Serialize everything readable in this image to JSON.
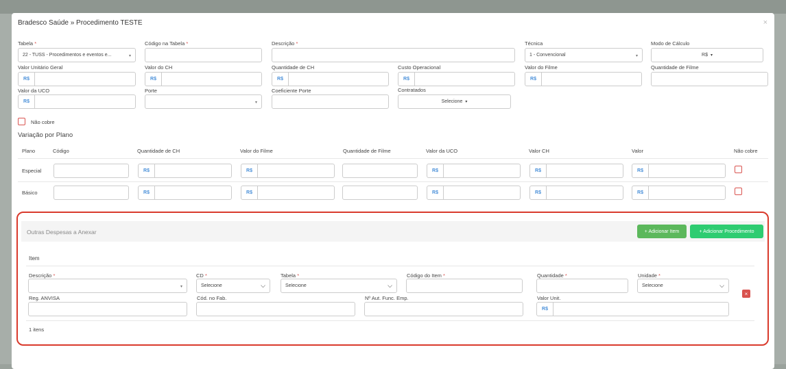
{
  "modal": {
    "title": "Bradesco Saúde » Procedimento TESTE",
    "close": "×"
  },
  "form": {
    "required_mark": "*",
    "tabela": {
      "label": "Tabela",
      "value": "22 - TUSS - Procedimentos e eventos e..."
    },
    "codigo_tabela": {
      "label": "Código na Tabela",
      "value": ""
    },
    "descricao": {
      "label": "Descrição",
      "value": ""
    },
    "tecnica": {
      "label": "Técnica",
      "value": "1 - Convencional"
    },
    "modo_calculo": {
      "label": "Modo de Cálculo",
      "value": "R$"
    },
    "valor_unitario_geral": {
      "label": "Valor Unitário Geral",
      "value": ""
    },
    "valor_ch": {
      "label": "Valor do CH",
      "value": ""
    },
    "quantidade_ch": {
      "label": "Quantidade de CH",
      "value": ""
    },
    "custo_operacional": {
      "label": "Custo Operacional",
      "value": ""
    },
    "valor_filme": {
      "label": "Valor do Filme",
      "value": ""
    },
    "quantidade_filme": {
      "label": "Quantidade de Filme",
      "value": ""
    },
    "valor_uco": {
      "label": "Valor da UCO",
      "value": ""
    },
    "porte": {
      "label": "Porte",
      "value": ""
    },
    "coeficiente_porte": {
      "label": "Coeficiente Porte",
      "value": ""
    },
    "contratados": {
      "label": "Contratados",
      "value": "Selecione"
    },
    "nao_cobre": {
      "label": "Não cobre",
      "checked": false
    },
    "currency_prefix": "R$"
  },
  "variacao": {
    "title": "Variação por Plano",
    "columns": [
      "Plano",
      "Código",
      "Quantidade de CH",
      "Valor do Filme",
      "Quantidade de Filme",
      "Valor da UCO",
      "Valor CH",
      "Valor",
      "Não cobre"
    ],
    "rows": [
      {
        "plano": "Especial"
      },
      {
        "plano": "Básico"
      }
    ]
  },
  "despesas": {
    "title": "Outras Despesas a Anexar",
    "add_item_label": "+ Adicionar Item",
    "add_procedimento_label": "+ Adicionar Procedimento",
    "item_header": "Item",
    "descricao_label": "Descrição",
    "cd_label": "CD",
    "cd_value": "Selecione",
    "tabela_label": "Tabela",
    "tabela_value": "Selecione",
    "codigo_item_label": "Código do Item",
    "quantidade_label": "Quantidade",
    "unidade_label": "Unidade",
    "unidade_value": "Selecione",
    "reg_anvisa_label": "Reg. ANVISA",
    "cod_fab_label": "Cód. no Fab.",
    "aut_func_label": "Nº Aut. Func. Emp.",
    "valor_unit_label": "Valor Unit.",
    "delete_label": "×",
    "count_text": "1 itens"
  }
}
